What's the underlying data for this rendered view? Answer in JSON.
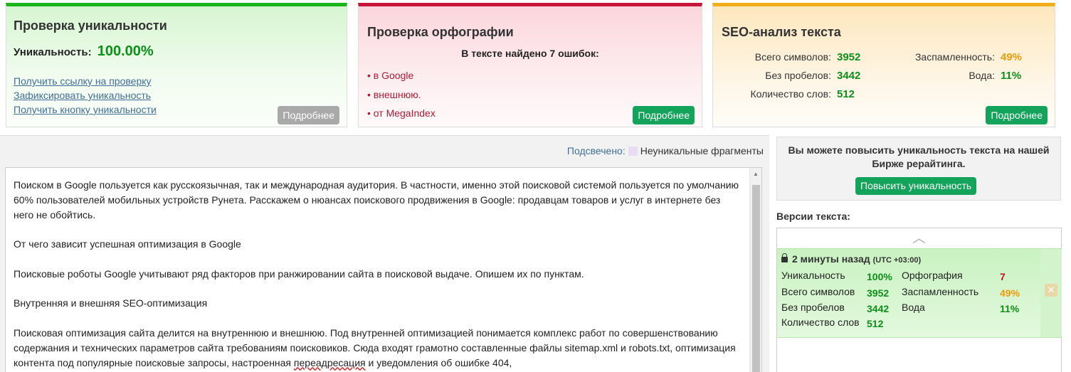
{
  "uniqueness": {
    "title": "Проверка уникальности",
    "label": "Уникальность:",
    "value": "100.00%",
    "links": [
      "Получить ссылку на проверку",
      "Зафиксировать уникальность",
      "Получить кнопку уникальности"
    ],
    "button": "Подробнее"
  },
  "spelling": {
    "title": "Проверка орфографии",
    "summary": "В тексте найдено 7 ошибок:",
    "errors": [
      "в Google",
      "внешнюю.",
      "от MegaIndex"
    ],
    "button": "Подробнее"
  },
  "seo": {
    "title": "SEO-анализ текста",
    "total_chars_label": "Всего символов:",
    "total_chars": "3952",
    "no_spaces_label": "Без пробелов:",
    "no_spaces": "3442",
    "words_label": "Количество слов:",
    "words": "512",
    "spam_label": "Заспамленность:",
    "spam": "49%",
    "water_label": "Вода:",
    "water": "11%",
    "button": "Подробнее"
  },
  "highlight": {
    "label": "Подсвечено:",
    "legend": "Неуникальные фрагменты"
  },
  "text": {
    "p1": "Поиском в Google пользуется как русскоязычная, так и международная аудитория. В частности, именно этой поисковой системой пользуется по умолчанию 60% пользователей мобильных устройств Рунета. Расскажем о нюансах поискового продвижения в Google: продавцам товаров и услуг в интернете без него не обойтись.",
    "p2": "От чего зависит успешная оптимизация в Google",
    "p3": "Поисковые роботы Google учитывают ряд факторов при ранжировании сайта в поисковой выдаче. Опишем их по пунктам.",
    "p4": "Внутренняя и внешняя SEO-оптимизация",
    "p5a": "Поисковая оптимизация сайта делится на внутреннюю и внешнюю. Под внутренней оптимизацией понимается комплекс работ по совершенствованию содержания и технических параметров сайта требованиям поисковиков. Сюда входят грамотно составленные файлы sitemap.xml и robots.txt, оптимизация контента под популярные поисковые запросы, настроенная ",
    "p5_err": "переадресация",
    "p5b": " и уведомления об ошибке 404,"
  },
  "promo": {
    "text": "Вы можете повысить уникальность текста на нашей Бирже рерайтинга.",
    "button": "Повысить уникальность"
  },
  "versions": {
    "title": "Версии текста:",
    "item": {
      "time": "2 минуты назад",
      "tz": "(UTC +03:00)",
      "uniq_label": "Уникальность",
      "uniq": "100%",
      "spell_label": "Орфография",
      "spell": "7",
      "total_label": "Всего символов",
      "total": "3952",
      "spam_label": "Заспамленность",
      "spam": "49%",
      "nospace_label": "Без пробелов",
      "nospace": "3442",
      "water_label": "Вода",
      "water": "11%",
      "words_label": "Количество слов",
      "words": "512"
    }
  },
  "colors": {
    "uniq_accent": "#19b31b",
    "spell_accent": "#c7143a",
    "seo_accent": "#f1ae19",
    "button_green": "#13a35a"
  }
}
